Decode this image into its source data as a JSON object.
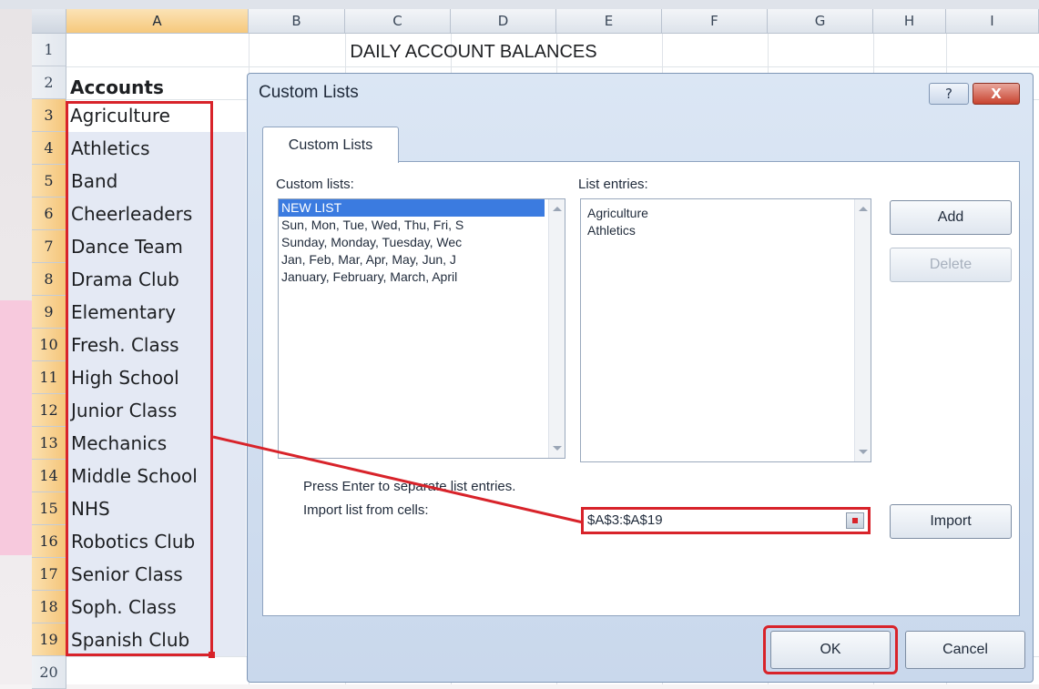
{
  "spreadsheet": {
    "columns": [
      "A",
      "B",
      "C",
      "D",
      "E",
      "F",
      "G",
      "H",
      "I"
    ],
    "rows": [
      "1",
      "2",
      "3",
      "4",
      "5",
      "6",
      "7",
      "8",
      "9",
      "10",
      "11",
      "12",
      "13",
      "14",
      "15",
      "16",
      "17",
      "18",
      "19",
      "20"
    ],
    "title": "DAILY ACCOUNT BALANCES",
    "accounts_header": "Accounts",
    "accounts": [
      "Agriculture",
      "Athletics",
      "Band",
      "Cheerleaders",
      "Dance Team",
      "Drama Club",
      "Elementary",
      "Fresh. Class",
      "High School",
      "Junior Class",
      "Mechanics",
      "Middle School",
      "NHS",
      "Robotics Club",
      "Senior Class",
      "Soph. Class",
      "Spanish Club"
    ]
  },
  "dialog": {
    "title": "Custom Lists",
    "help_label": "?",
    "close_label": "X",
    "tab_label": "Custom Lists",
    "custom_lists_label": "Custom lists:",
    "custom_lists": [
      "NEW LIST",
      "Sun, Mon, Tue, Wed, Thu, Fri, S",
      "Sunday, Monday, Tuesday, Wec",
      "Jan, Feb, Mar, Apr, May, Jun, J",
      "January, February, March, April"
    ],
    "list_entries_label": "List entries:",
    "list_entries": [
      "Agriculture",
      "Athletics"
    ],
    "add_label": "Add",
    "delete_label": "Delete",
    "hint": "Press Enter to separate list entries.",
    "import_label": "Import list from cells:",
    "import_value": "$A$3:$A$19",
    "import_button": "Import",
    "ok_label": "OK",
    "cancel_label": "Cancel"
  },
  "colors": {
    "highlight": "#d8232a",
    "selection": "#3b7be0"
  }
}
